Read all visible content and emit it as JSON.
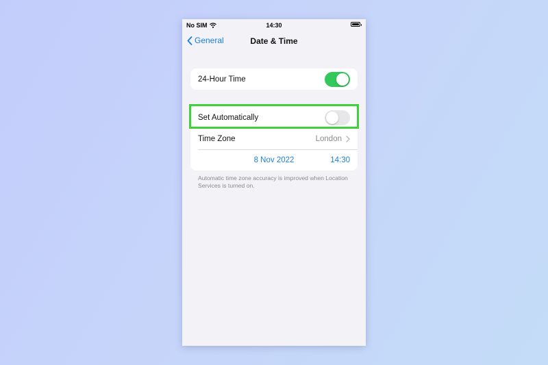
{
  "status_bar": {
    "carrier": "No SIM",
    "time": "14:30"
  },
  "nav": {
    "back_label": "General",
    "title": "Date & Time"
  },
  "settings": {
    "hour24": {
      "label": "24-Hour Time",
      "on": true
    },
    "set_automatically": {
      "label": "Set Automatically",
      "on": false
    },
    "time_zone": {
      "label": "Time Zone",
      "value": "London"
    },
    "date": "8 Nov 2022",
    "time": "14:30"
  },
  "footnote": "Automatic time zone accuracy is improved when Location Services is turned on.",
  "colors": {
    "accent": "#1a7fe0",
    "toggle_on": "#34c759",
    "highlight": "#3fd13a"
  },
  "icons": [
    "wifi-icon",
    "battery-icon",
    "chevron-left-icon",
    "chevron-right-icon"
  ]
}
